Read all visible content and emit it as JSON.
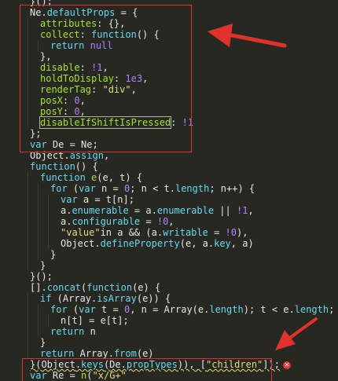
{
  "lines": [
    {
      "indent": 1,
      "tokens": [
        {
          "t": "}();",
          "c": "p"
        }
      ]
    },
    {
      "indent": 1,
      "tokens": [
        {
          "t": "Ne",
          "c": "p"
        },
        {
          "t": ".",
          "c": "p"
        },
        {
          "t": "defaultProps",
          "c": "k"
        },
        {
          "t": " = {",
          "c": "p"
        }
      ]
    },
    {
      "indent": 2,
      "tokens": [
        {
          "t": "attributes",
          "c": "f"
        },
        {
          "t": ": {},",
          "c": "p"
        }
      ]
    },
    {
      "indent": 2,
      "tokens": [
        {
          "t": "collect",
          "c": "f"
        },
        {
          "t": ": ",
          "c": "p"
        },
        {
          "t": "function",
          "c": "k"
        },
        {
          "t": "() {",
          "c": "p"
        }
      ]
    },
    {
      "indent": 3,
      "tokens": [
        {
          "t": "return",
          "c": "k"
        },
        {
          "t": " ",
          "c": "p"
        },
        {
          "t": "null",
          "c": "n"
        }
      ]
    },
    {
      "indent": 2,
      "tokens": [
        {
          "t": "},",
          "c": "p"
        }
      ]
    },
    {
      "indent": 2,
      "tokens": [
        {
          "t": "disable",
          "c": "f"
        },
        {
          "t": ": ",
          "c": "p"
        },
        {
          "t": "!1",
          "c": "n"
        },
        {
          "t": ",",
          "c": "p"
        }
      ]
    },
    {
      "indent": 2,
      "tokens": [
        {
          "t": "holdToDisplay",
          "c": "f"
        },
        {
          "t": ": ",
          "c": "p"
        },
        {
          "t": "1e3",
          "c": "n"
        },
        {
          "t": ",",
          "c": "p"
        }
      ]
    },
    {
      "indent": 2,
      "tokens": [
        {
          "t": "renderTag",
          "c": "f"
        },
        {
          "t": ": ",
          "c": "p"
        },
        {
          "t": "\"div\"",
          "c": "s"
        },
        {
          "t": ",",
          "c": "p"
        }
      ]
    },
    {
      "indent": 2,
      "tokens": [
        {
          "t": "posX",
          "c": "f"
        },
        {
          "t": ": ",
          "c": "p"
        },
        {
          "t": "0",
          "c": "n"
        },
        {
          "t": ",",
          "c": "p"
        }
      ]
    },
    {
      "indent": 2,
      "tokens": [
        {
          "t": "posY",
          "c": "f"
        },
        {
          "t": ": ",
          "c": "p"
        },
        {
          "t": "0",
          "c": "n"
        },
        {
          "t": ",",
          "c": "p"
        }
      ]
    },
    {
      "indent": 2,
      "tokens": [
        {
          "t": "disableIfShiftIsPressed",
          "c": "f",
          "boxed": true
        },
        {
          "t": ": ",
          "c": "p"
        },
        {
          "t": "!1",
          "c": "n"
        }
      ]
    },
    {
      "indent": 1,
      "tokens": [
        {
          "t": "};",
          "c": "p"
        }
      ]
    },
    {
      "indent": 1,
      "tokens": [
        {
          "t": "var",
          "c": "k"
        },
        {
          "t": " De = Ne;",
          "c": "p"
        }
      ]
    },
    {
      "indent": 1,
      "tokens": [
        {
          "t": "Object",
          "c": "p"
        },
        {
          "t": ".",
          "c": "p"
        },
        {
          "t": "assign",
          "c": "k"
        },
        {
          "t": ",",
          "c": "p"
        }
      ]
    },
    {
      "indent": 1,
      "tokens": [
        {
          "t": "function",
          "c": "k"
        },
        {
          "t": "() {",
          "c": "p"
        }
      ]
    },
    {
      "indent": 2,
      "tokens": [
        {
          "t": "function",
          "c": "k"
        },
        {
          "t": " ",
          "c": "p"
        },
        {
          "t": "e",
          "c": "f"
        },
        {
          "t": "(e, t) {",
          "c": "p"
        }
      ]
    },
    {
      "indent": 3,
      "tokens": [
        {
          "t": "for",
          "c": "k"
        },
        {
          "t": " (",
          "c": "p"
        },
        {
          "t": "var",
          "c": "k"
        },
        {
          "t": " n = ",
          "c": "p"
        },
        {
          "t": "0",
          "c": "n"
        },
        {
          "t": "; n < t.",
          "c": "p"
        },
        {
          "t": "length",
          "c": "k"
        },
        {
          "t": "; n++) {",
          "c": "p"
        }
      ]
    },
    {
      "indent": 4,
      "tokens": [
        {
          "t": "var",
          "c": "k"
        },
        {
          "t": " a = t[n];",
          "c": "p"
        }
      ]
    },
    {
      "indent": 4,
      "tokens": [
        {
          "t": "a.",
          "c": "p"
        },
        {
          "t": "enumerable",
          "c": "k"
        },
        {
          "t": " = a.",
          "c": "p"
        },
        {
          "t": "enumerable",
          "c": "k"
        },
        {
          "t": " || ",
          "c": "p"
        },
        {
          "t": "!1",
          "c": "n"
        },
        {
          "t": ",",
          "c": "p"
        }
      ]
    },
    {
      "indent": 4,
      "tokens": [
        {
          "t": "a.",
          "c": "p"
        },
        {
          "t": "configurable",
          "c": "k"
        },
        {
          "t": " = ",
          "c": "p"
        },
        {
          "t": "!0",
          "c": "n"
        },
        {
          "t": ",",
          "c": "p"
        }
      ]
    },
    {
      "indent": 4,
      "tokens": [
        {
          "t": "\"value\"",
          "c": "s"
        },
        {
          "t": "in a && (a.",
          "c": "p"
        },
        {
          "t": "writable",
          "c": "k"
        },
        {
          "t": " = ",
          "c": "p"
        },
        {
          "t": "!0",
          "c": "n"
        },
        {
          "t": "),",
          "c": "p"
        }
      ]
    },
    {
      "indent": 4,
      "tokens": [
        {
          "t": "Object",
          "c": "p"
        },
        {
          "t": ".",
          "c": "p"
        },
        {
          "t": "defineProperty",
          "c": "k"
        },
        {
          "t": "(e, a.",
          "c": "p"
        },
        {
          "t": "key",
          "c": "k"
        },
        {
          "t": ", a)",
          "c": "p"
        }
      ]
    },
    {
      "indent": 3,
      "tokens": [
        {
          "t": "}",
          "c": "p"
        }
      ]
    },
    {
      "indent": 2,
      "tokens": [
        {
          "t": "}",
          "c": "p"
        }
      ]
    },
    {
      "indent": 1,
      "tokens": [
        {
          "t": "}();",
          "c": "p"
        }
      ]
    },
    {
      "indent": 1,
      "tokens": [
        {
          "t": "[].",
          "c": "p"
        },
        {
          "t": "concat",
          "c": "k"
        },
        {
          "t": "(",
          "c": "p"
        },
        {
          "t": "function",
          "c": "k"
        },
        {
          "t": "(e) {",
          "c": "p"
        }
      ]
    },
    {
      "indent": 2,
      "tokens": [
        {
          "t": "if",
          "c": "k"
        },
        {
          "t": " (",
          "c": "p"
        },
        {
          "t": "Array",
          "c": "p"
        },
        {
          "t": ".",
          "c": "p"
        },
        {
          "t": "isArray",
          "c": "k"
        },
        {
          "t": "(e)) {",
          "c": "p"
        }
      ]
    },
    {
      "indent": 3,
      "tokens": [
        {
          "t": "for",
          "c": "k"
        },
        {
          "t": " (",
          "c": "p"
        },
        {
          "t": "var",
          "c": "k"
        },
        {
          "t": " t = ",
          "c": "p"
        },
        {
          "t": "0",
          "c": "n"
        },
        {
          "t": ", n = ",
          "c": "p"
        },
        {
          "t": "Array",
          "c": "p"
        },
        {
          "t": "(e.",
          "c": "p"
        },
        {
          "t": "length",
          "c": "k"
        },
        {
          "t": "); t < e.",
          "c": "p"
        },
        {
          "t": "length",
          "c": "k"
        },
        {
          "t": "; t++)",
          "c": "p"
        }
      ]
    },
    {
      "indent": 4,
      "tokens": [
        {
          "t": "n[t] = e[t];",
          "c": "p"
        }
      ]
    },
    {
      "indent": 3,
      "tokens": [
        {
          "t": "return",
          "c": "k"
        },
        {
          "t": " n",
          "c": "p"
        }
      ]
    },
    {
      "indent": 2,
      "tokens": [
        {
          "t": "}",
          "c": "p"
        }
      ]
    },
    {
      "indent": 2,
      "tokens": [
        {
          "t": "return",
          "c": "k"
        },
        {
          "t": " ",
          "c": "p"
        },
        {
          "t": "Array",
          "c": "p"
        },
        {
          "t": ".",
          "c": "p"
        },
        {
          "t": "from",
          "c": "k"
        },
        {
          "t": "(e)",
          "c": "p"
        }
      ]
    },
    {
      "indent": 1,
      "tokens": [
        {
          "t": "}(",
          "c": "p"
        },
        {
          "t": "Object",
          "c": "p"
        },
        {
          "t": ".",
          "c": "p"
        },
        {
          "t": "keys",
          "c": "k"
        },
        {
          "t": "(De.",
          "c": "p"
        },
        {
          "t": "propTypes",
          "c": "k"
        },
        {
          "t": ")), [",
          "c": "p"
        },
        {
          "t": "\"children\"",
          "c": "s"
        },
        {
          "t": "]);",
          "c": "p"
        }
      ],
      "error": true,
      "squiggle": true
    },
    {
      "indent": 1,
      "tokens": [
        {
          "t": "var",
          "c": "k"
        },
        {
          "t": " Re = ",
          "c": "p"
        },
        {
          "t": "n",
          "c": "f"
        },
        {
          "t": "(",
          "c": "p"
        },
        {
          "t": "\"x/G+\"",
          "c": "s"
        }
      ]
    }
  ],
  "colors": {
    "background": "#272822",
    "keyword": "#66d9ef",
    "string": "#e6db74",
    "number": "#ae81ff",
    "name": "#a6e22e",
    "annotation": "#e0322d"
  },
  "annotations": {
    "top_box": "defaultProps-block",
    "bottom_box": "propTypes-line"
  }
}
